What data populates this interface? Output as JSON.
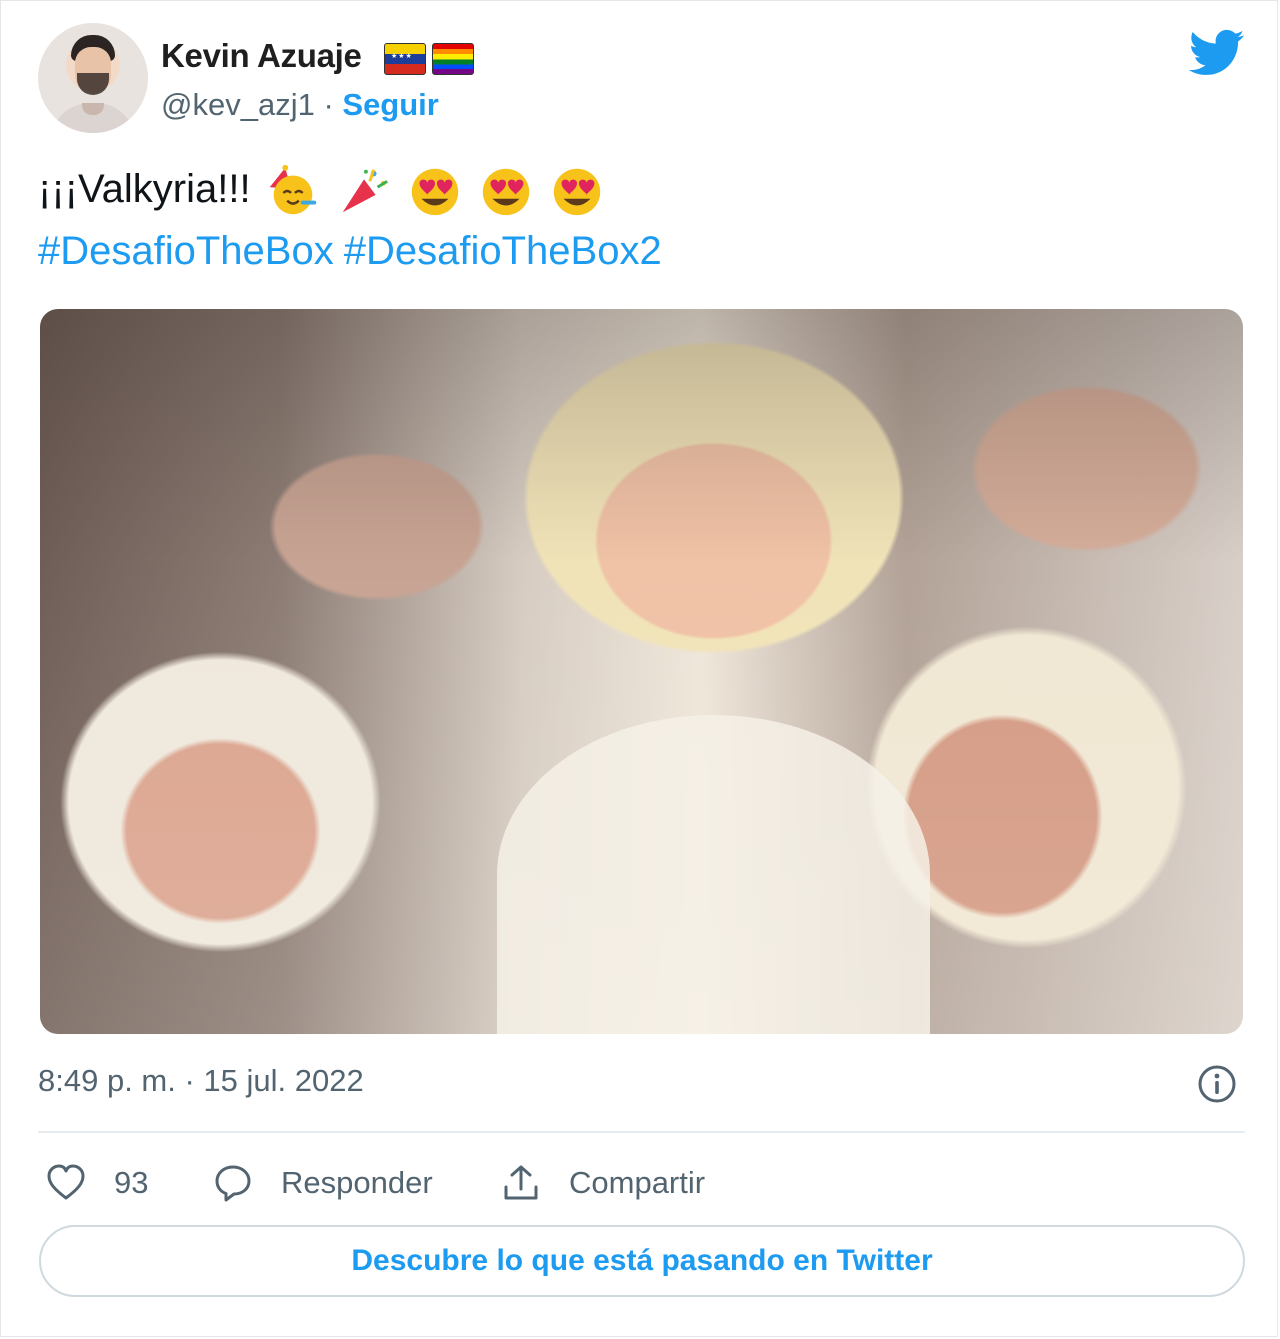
{
  "author": {
    "name": "Kevin Azuaje",
    "handle": "@kev_azj1",
    "separator": " · ",
    "follow_label": "Seguir"
  },
  "tweet": {
    "text": "¡¡¡Valkyria!!! ",
    "emojis": [
      "partying-face",
      "party-popper",
      "heart-eyes",
      "heart-eyes",
      "heart-eyes"
    ],
    "hashtags": [
      "#DesafioTheBox",
      "#DesafioTheBox2"
    ]
  },
  "meta": {
    "timestamp": "8:49 p. m. · 15 jul. 2022"
  },
  "actions": {
    "like_count": "93",
    "reply_label": "Responder",
    "share_label": "Compartir"
  },
  "cta": {
    "label": "Descubre lo que está pasando en Twitter"
  },
  "colors": {
    "accent": "#1d9bf0",
    "secondary_text": "#536471",
    "primary_text": "#0f1419"
  }
}
